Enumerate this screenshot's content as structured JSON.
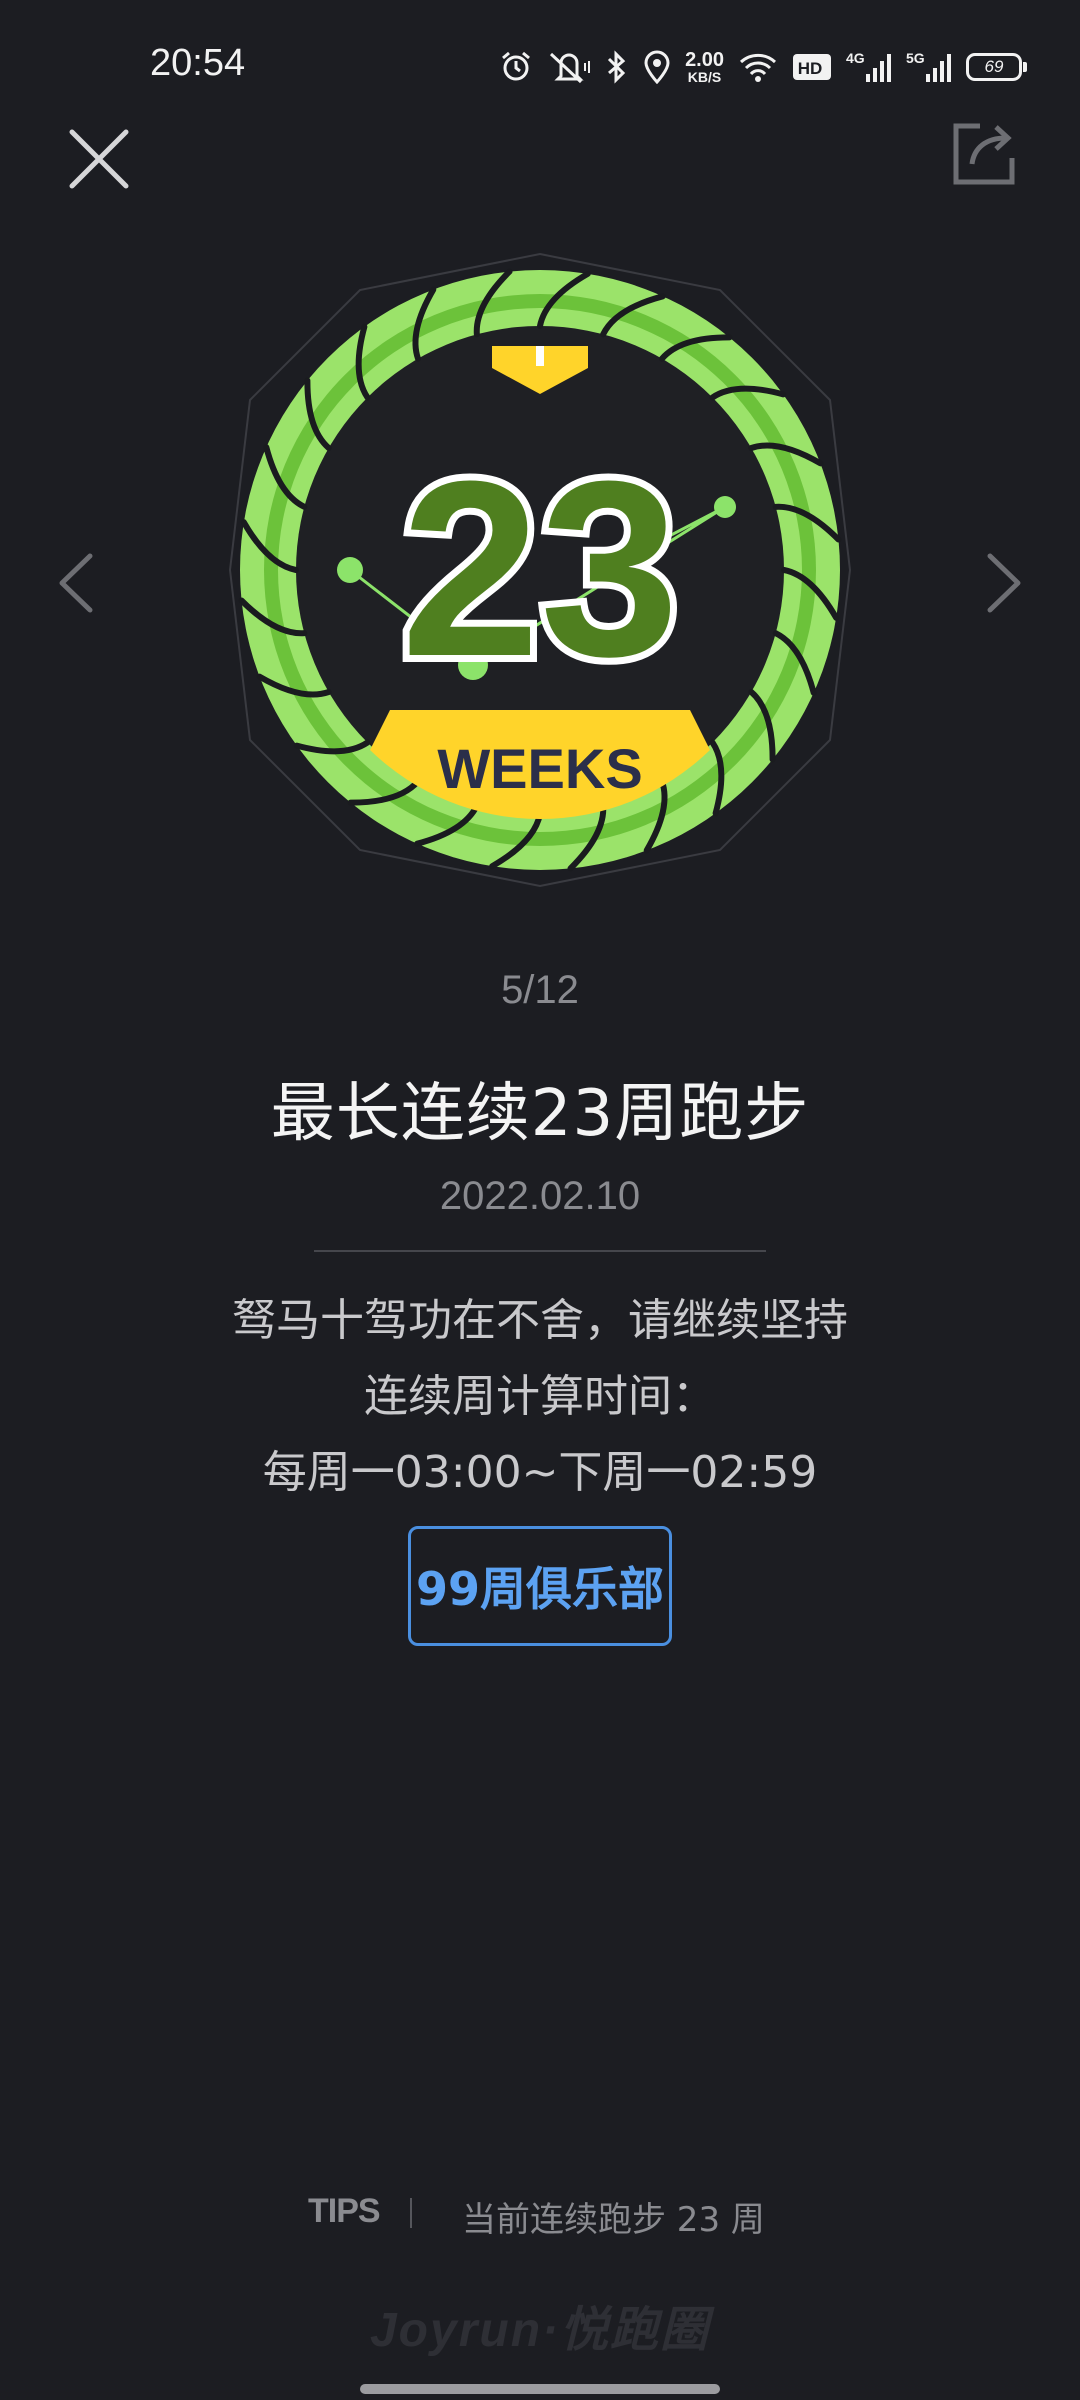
{
  "status_bar": {
    "time": "20:54",
    "net_speed_value": "2.00",
    "net_speed_unit": "KB/S",
    "hd_label": "HD",
    "network_4g": "4G",
    "network_5g": "5G",
    "battery": "69"
  },
  "badge": {
    "number": "23",
    "unit": "WEEKS",
    "colors": {
      "ring_light": "#9be36a",
      "ring_dark": "#6cc23a",
      "number_fill": "#4f7f1f",
      "banner": "#ffd42a",
      "inner": "#1f2024"
    }
  },
  "counter": "5/12",
  "title": "最长连续23周跑步",
  "date": "2022.02.10",
  "description": {
    "line1": "驽马十驾功在不舍，请继续坚持",
    "line2": "连续周计算时间：",
    "line3": "每周一03:00~下周一02:59"
  },
  "club_button": "99周俱乐部",
  "tips": {
    "label": "TIPS",
    "text": "当前连续跑步 23 周"
  },
  "brand": "Joyrun·悦跑圈"
}
